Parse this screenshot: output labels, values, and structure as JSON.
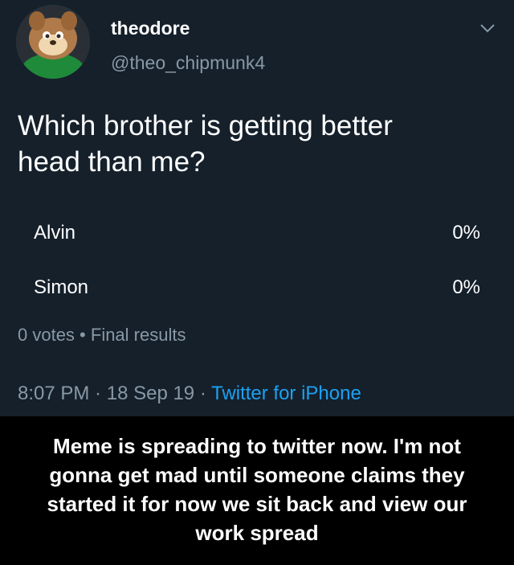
{
  "tweet": {
    "display_name": "theodore",
    "handle": "@theo_chipmunk4",
    "text_lines": [
      "Which brother is getting better",
      "head than me?"
    ],
    "poll": {
      "options": [
        {
          "label": "Alvin",
          "percent": "0%"
        },
        {
          "label": "Simon",
          "percent": "0%"
        }
      ],
      "votes": "0 votes",
      "separator": " • ",
      "status": "Final results"
    },
    "time": "8:07 PM",
    "date": "18 Sep 19",
    "sep": " · ",
    "source": "Twitter for iPhone"
  },
  "caption": {
    "lines": [
      "Meme is spreading to twitter now. I'm not",
      "gonna get mad until someone claims they",
      "started it for now we sit back and view our",
      "work spread"
    ]
  },
  "colors": {
    "tweet_background": "#15202b",
    "page_background": "#000000",
    "secondary_text": "#8899a6",
    "link": "#1da1f2"
  },
  "icons": {
    "avatar": "chipmunk-avatar",
    "menu": "chevron-down-icon"
  }
}
